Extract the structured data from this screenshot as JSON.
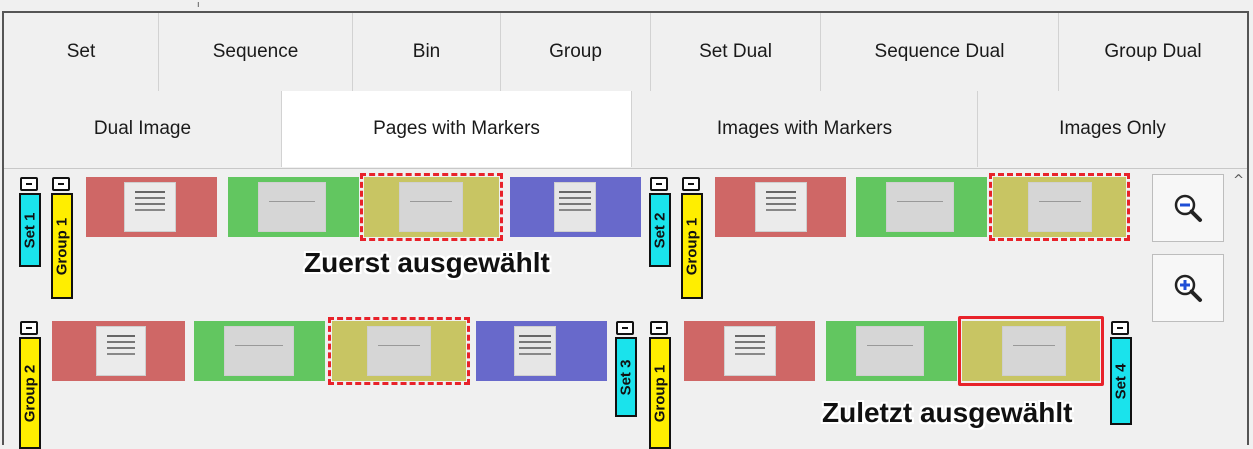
{
  "tabs": {
    "row1": [
      "Set",
      "Sequence",
      "Bin",
      "Group",
      "Set Dual",
      "Sequence Dual",
      "Group Dual"
    ],
    "row2": [
      "Dual Image",
      "Pages with Markers",
      "Images with Markers",
      "Images Only"
    ],
    "active": "Pages with Markers"
  },
  "markers": {
    "set1": "Set 1",
    "group1a": "Group 1",
    "set2": "Set 2",
    "group1b": "Group 1",
    "group2": "Group 2",
    "set3": "Set 3",
    "group1c": "Group 1",
    "set4": "Set 4"
  },
  "callouts": {
    "first": "Zuerst ausgewählt",
    "last": "Zuletzt ausgewählt"
  },
  "zoom": {
    "out_icon": "zoom-out-icon",
    "in_icon": "zoom-in-icon"
  },
  "colors": {
    "red_thumb": "#cf6766",
    "green_thumb": "#62c660",
    "yellow_thumb": "#c8c563",
    "blue_thumb": "#6869cb",
    "set_marker": "#1ae3ec",
    "group_marker": "#ffee00",
    "selection": "#e8222a"
  }
}
